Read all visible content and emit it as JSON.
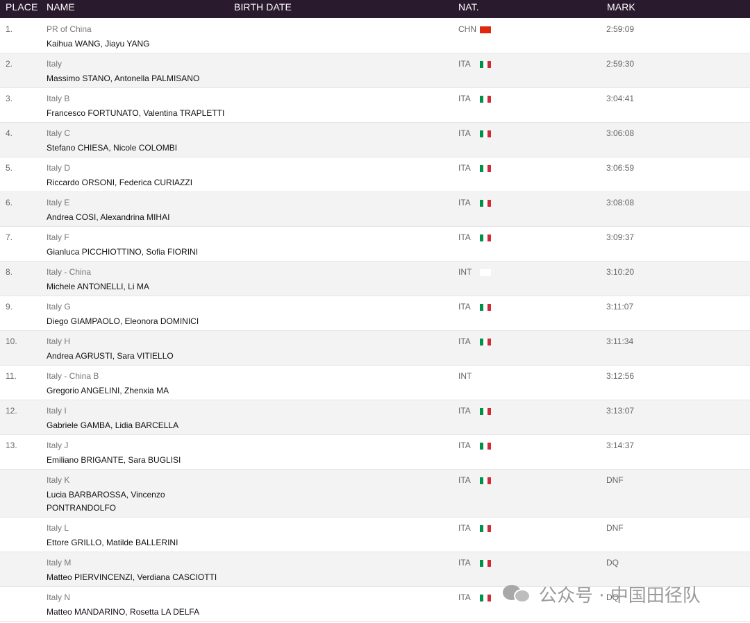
{
  "header": {
    "place": "PLACE",
    "name": "NAME",
    "birth_date": "BIRTH DATE",
    "nat": "NAT.",
    "mark": "MARK"
  },
  "rows": [
    {
      "place": "1.",
      "team": "PR of China",
      "athletes": "Kaihua WANG, Jiayu YANG",
      "nat": "CHN",
      "flag": "chn",
      "mark": "2:59:09"
    },
    {
      "place": "2.",
      "team": "Italy",
      "athletes": "Massimo STANO, Antonella PALMISANO",
      "nat": "ITA",
      "flag": "ita",
      "mark": "2:59:30"
    },
    {
      "place": "3.",
      "team": "Italy B",
      "athletes": "Francesco FORTUNATO, Valentina TRAPLETTI",
      "nat": "ITA",
      "flag": "ita",
      "mark": "3:04:41"
    },
    {
      "place": "4.",
      "team": "Italy C",
      "athletes": "Stefano CHIESA, Nicole COLOMBI",
      "nat": "ITA",
      "flag": "ita",
      "mark": "3:06:08"
    },
    {
      "place": "5.",
      "team": "Italy D",
      "athletes": "Riccardo ORSONI, Federica CURIAZZI",
      "nat": "ITA",
      "flag": "ita",
      "mark": "3:06:59"
    },
    {
      "place": "6.",
      "team": "Italy E",
      "athletes": "Andrea COSI, Alexandrina MIHAI",
      "nat": "ITA",
      "flag": "ita",
      "mark": "3:08:08"
    },
    {
      "place": "7.",
      "team": "Italy F",
      "athletes": "Gianluca PICCHIOTTINO, Sofia FIORINI",
      "nat": "ITA",
      "flag": "ita",
      "mark": "3:09:37"
    },
    {
      "place": "8.",
      "team": "Italy - China",
      "athletes": "Michele ANTONELLI, Li MA",
      "nat": "INT",
      "flag": "int",
      "mark": "3:10:20"
    },
    {
      "place": "9.",
      "team": "Italy G",
      "athletes": "Diego GIAMPAOLO, Eleonora DOMINICI",
      "nat": "ITA",
      "flag": "ita",
      "mark": "3:11:07"
    },
    {
      "place": "10.",
      "team": "Italy H",
      "athletes": "Andrea AGRUSTI, Sara VITIELLO",
      "nat": "ITA",
      "flag": "ita",
      "mark": "3:11:34"
    },
    {
      "place": "11.",
      "team": "Italy - China B",
      "athletes": "Gregorio ANGELINI, Zhenxia MA",
      "nat": "INT",
      "flag": "",
      "mark": "3:12:56"
    },
    {
      "place": "12.",
      "team": "Italy I",
      "athletes": "Gabriele GAMBA, Lidia BARCELLA",
      "nat": "ITA",
      "flag": "ita",
      "mark": "3:13:07"
    },
    {
      "place": "13.",
      "team": "Italy J",
      "athletes": "Emiliano BRIGANTE, Sara BUGLISI",
      "nat": "ITA",
      "flag": "ita",
      "mark": "3:14:37"
    },
    {
      "place": "",
      "team": "Italy K",
      "athletes": "Lucia BARBAROSSA, Vincenzo PONTRANDOLFO",
      "nat": "ITA",
      "flag": "ita",
      "mark": "DNF"
    },
    {
      "place": "",
      "team": "Italy L",
      "athletes": "Ettore GRILLO, Matilde BALLERINI",
      "nat": "ITA",
      "flag": "ita",
      "mark": "DNF"
    },
    {
      "place": "",
      "team": "Italy M",
      "athletes": "Matteo PIERVINCENZI, Verdiana CASCIOTTI",
      "nat": "ITA",
      "flag": "ita",
      "mark": "DQ"
    },
    {
      "place": "",
      "team": "Italy N",
      "athletes": "Matteo MANDARINO, Rosetta LA DELFA",
      "nat": "ITA",
      "flag": "ita",
      "mark": "DQ"
    }
  ],
  "watermark": {
    "icon": "wechat-icon",
    "text": "公众号 · 中国田径队"
  },
  "colors": {
    "header_bg": "#2a1a2e",
    "row_alt_bg": "#f3f3f3",
    "flag_china_red": "#de2910",
    "flag_italy_green": "#009246",
    "flag_italy_red": "#ce2b37"
  }
}
